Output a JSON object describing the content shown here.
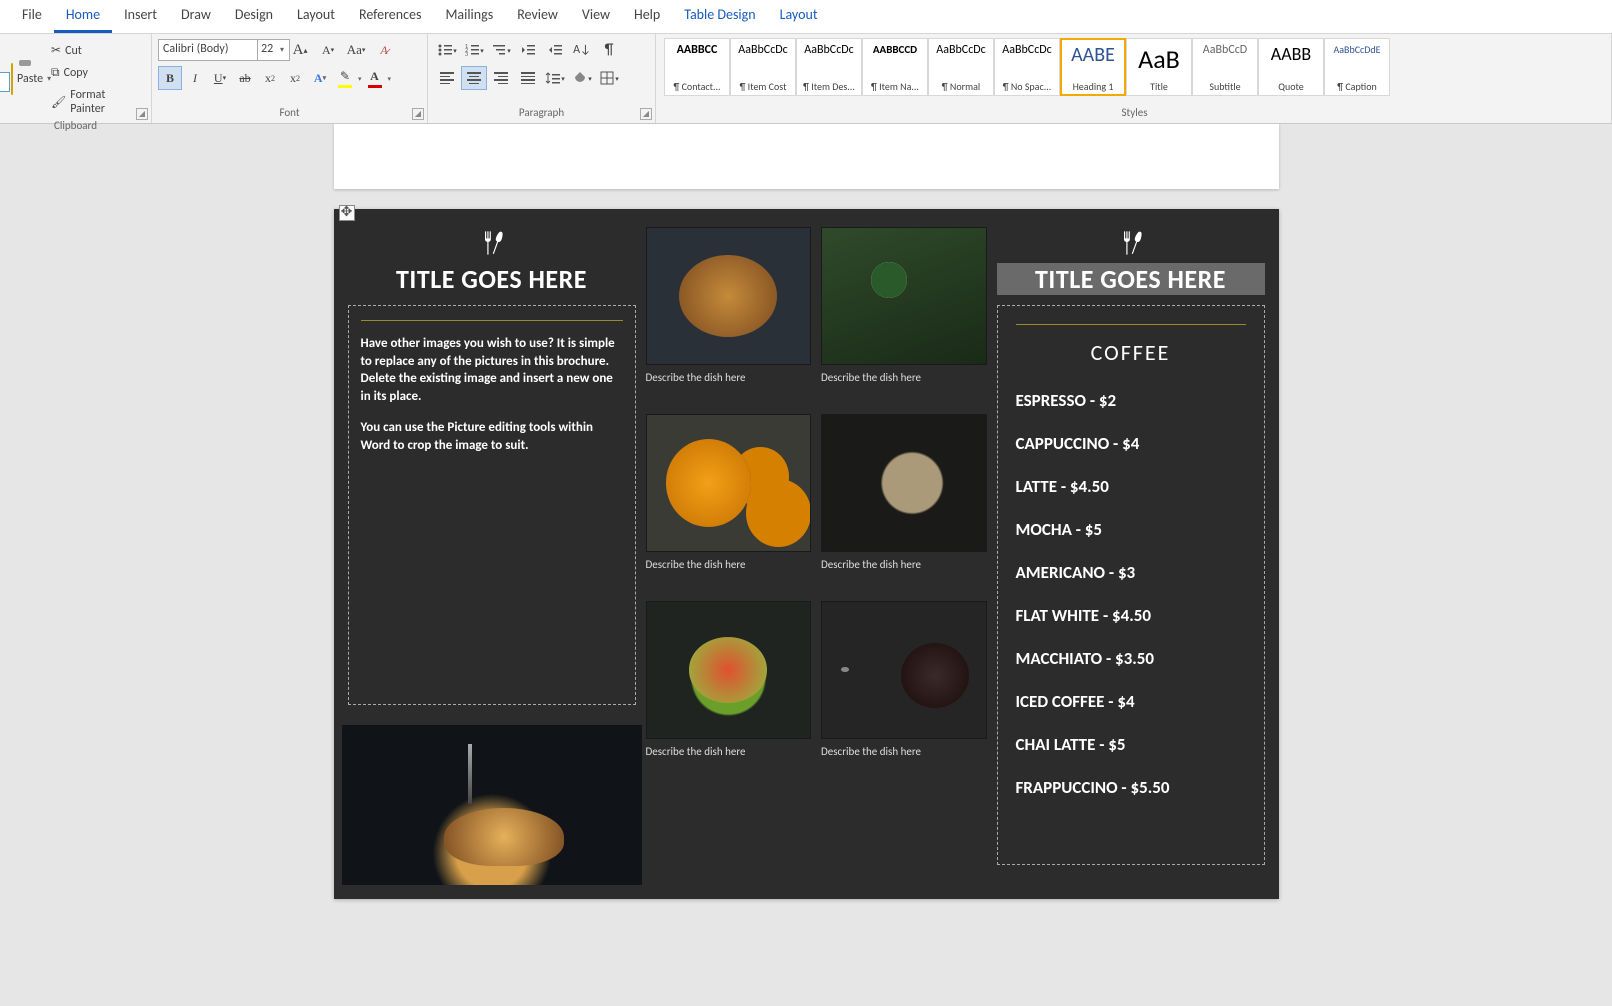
{
  "tabs": [
    "File",
    "Home",
    "Insert",
    "Draw",
    "Design",
    "Layout",
    "References",
    "Mailings",
    "Review",
    "View",
    "Help",
    "Table Design",
    "Layout"
  ],
  "active_tab_index": 1,
  "context_tab_indices": [
    11,
    12
  ],
  "clipboard": {
    "paste": "Paste",
    "cut": "Cut",
    "copy": "Copy",
    "format_painter": "Format Painter",
    "group": "Clipboard"
  },
  "font": {
    "family": "Calibri (Body)",
    "size": "22",
    "group": "Font"
  },
  "paragraph": {
    "group": "Paragraph"
  },
  "styles_group": "Styles",
  "styles": [
    {
      "preview": "AABBCC",
      "name": "¶ Contact...",
      "ps": "12px",
      "weight": "700",
      "color": "#000"
    },
    {
      "preview": "AaBbCcDc",
      "name": "¶ Item Cost",
      "ps": "12px",
      "weight": "400",
      "color": "#000"
    },
    {
      "preview": "AaBbCcDc",
      "name": "¶ Item Des...",
      "ps": "12px",
      "weight": "400",
      "color": "#000"
    },
    {
      "preview": "AABBCCD",
      "name": "¶ Item Na...",
      "ps": "11px",
      "weight": "700",
      "color": "#000"
    },
    {
      "preview": "AaBbCcDc",
      "name": "¶ Normal",
      "ps": "12px",
      "weight": "400",
      "color": "#000"
    },
    {
      "preview": "AaBbCcDc",
      "name": "¶ No Spac...",
      "ps": "12px",
      "weight": "400",
      "color": "#000"
    },
    {
      "preview": "AABE",
      "name": "Heading 1",
      "ps": "20px",
      "weight": "400",
      "color": "#2f5496",
      "selected": true
    },
    {
      "preview": "AaB",
      "name": "Title",
      "ps": "26px",
      "weight": "300",
      "color": "#000"
    },
    {
      "preview": "AaBbCcD",
      "name": "Subtitle",
      "ps": "12px",
      "weight": "400",
      "color": "#666"
    },
    {
      "preview": "AABB",
      "name": "Quote",
      "ps": "18px",
      "weight": "400",
      "color": "#000"
    },
    {
      "preview": "AaBbCcDdE",
      "name": "¶ Caption",
      "ps": "10px",
      "weight": "400",
      "color": "#2f5496"
    }
  ],
  "doc": {
    "left_title": "TITLE GOES HERE",
    "right_title": "TITLE GOES HERE",
    "para1": "Have other images you wish to use?  It is simple to replace any of the pictures in this brochure. Delete the existing image and insert a new one in its place.",
    "para2": "You can use the Picture editing tools within Word to crop the image to suit.",
    "dish_caption": "Describe the dish here",
    "coffee_heading": "COFFEE",
    "menu": [
      "ESPRESSO - $2",
      "CAPPUCCINO - $4",
      "LATTE - $4.50",
      "MOCHA - $5",
      "AMERICANO - $3",
      "FLAT WHITE - $4.50",
      "MACCHIATO - $3.50",
      "ICED COFFEE - $4",
      "CHAI LATTE - $5",
      "FRAPPUCCINO - $5.50"
    ]
  }
}
